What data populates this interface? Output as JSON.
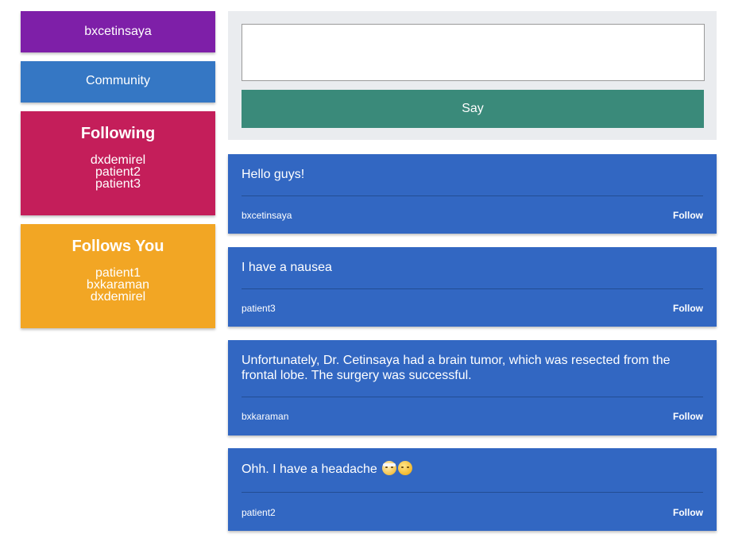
{
  "sidebar": {
    "username": "bxcetinsaya",
    "community_label": "Community",
    "following": {
      "title": "Following",
      "names": [
        "dxdemirel",
        "patient2",
        "patient3"
      ]
    },
    "follows_you": {
      "title": "Follows You",
      "names": [
        "patient1",
        "bxkaraman",
        "dxdemirel"
      ]
    }
  },
  "composer": {
    "value": "",
    "placeholder": "",
    "say_label": "Say"
  },
  "posts": [
    {
      "text": "Hello guys!",
      "author": "bxcetinsaya",
      "follow_label": "Follow"
    },
    {
      "text": "I have a nausea",
      "author": "patient3",
      "follow_label": "Follow"
    },
    {
      "text": "Unfortunately, Dr. Cetinsaya had a brain tumor, which was resected from the frontal lobe. The surgery was successful.",
      "author": "bxkaraman",
      "follow_label": "Follow"
    },
    {
      "text": "Ohh. I have a headache",
      "emojis": [
        "head-bandage-emoji-icon",
        "woozy-face-emoji-icon"
      ],
      "author": "patient2",
      "follow_label": "Follow"
    }
  ],
  "colors": {
    "user_card": "#7e1fa8",
    "community_card": "#3577c4",
    "following_card": "#c41e5a",
    "follows_you_card": "#f2a624",
    "composer_bg": "#eaecef",
    "say_button": "#3a8a7a",
    "post_bg": "#3267c2"
  }
}
